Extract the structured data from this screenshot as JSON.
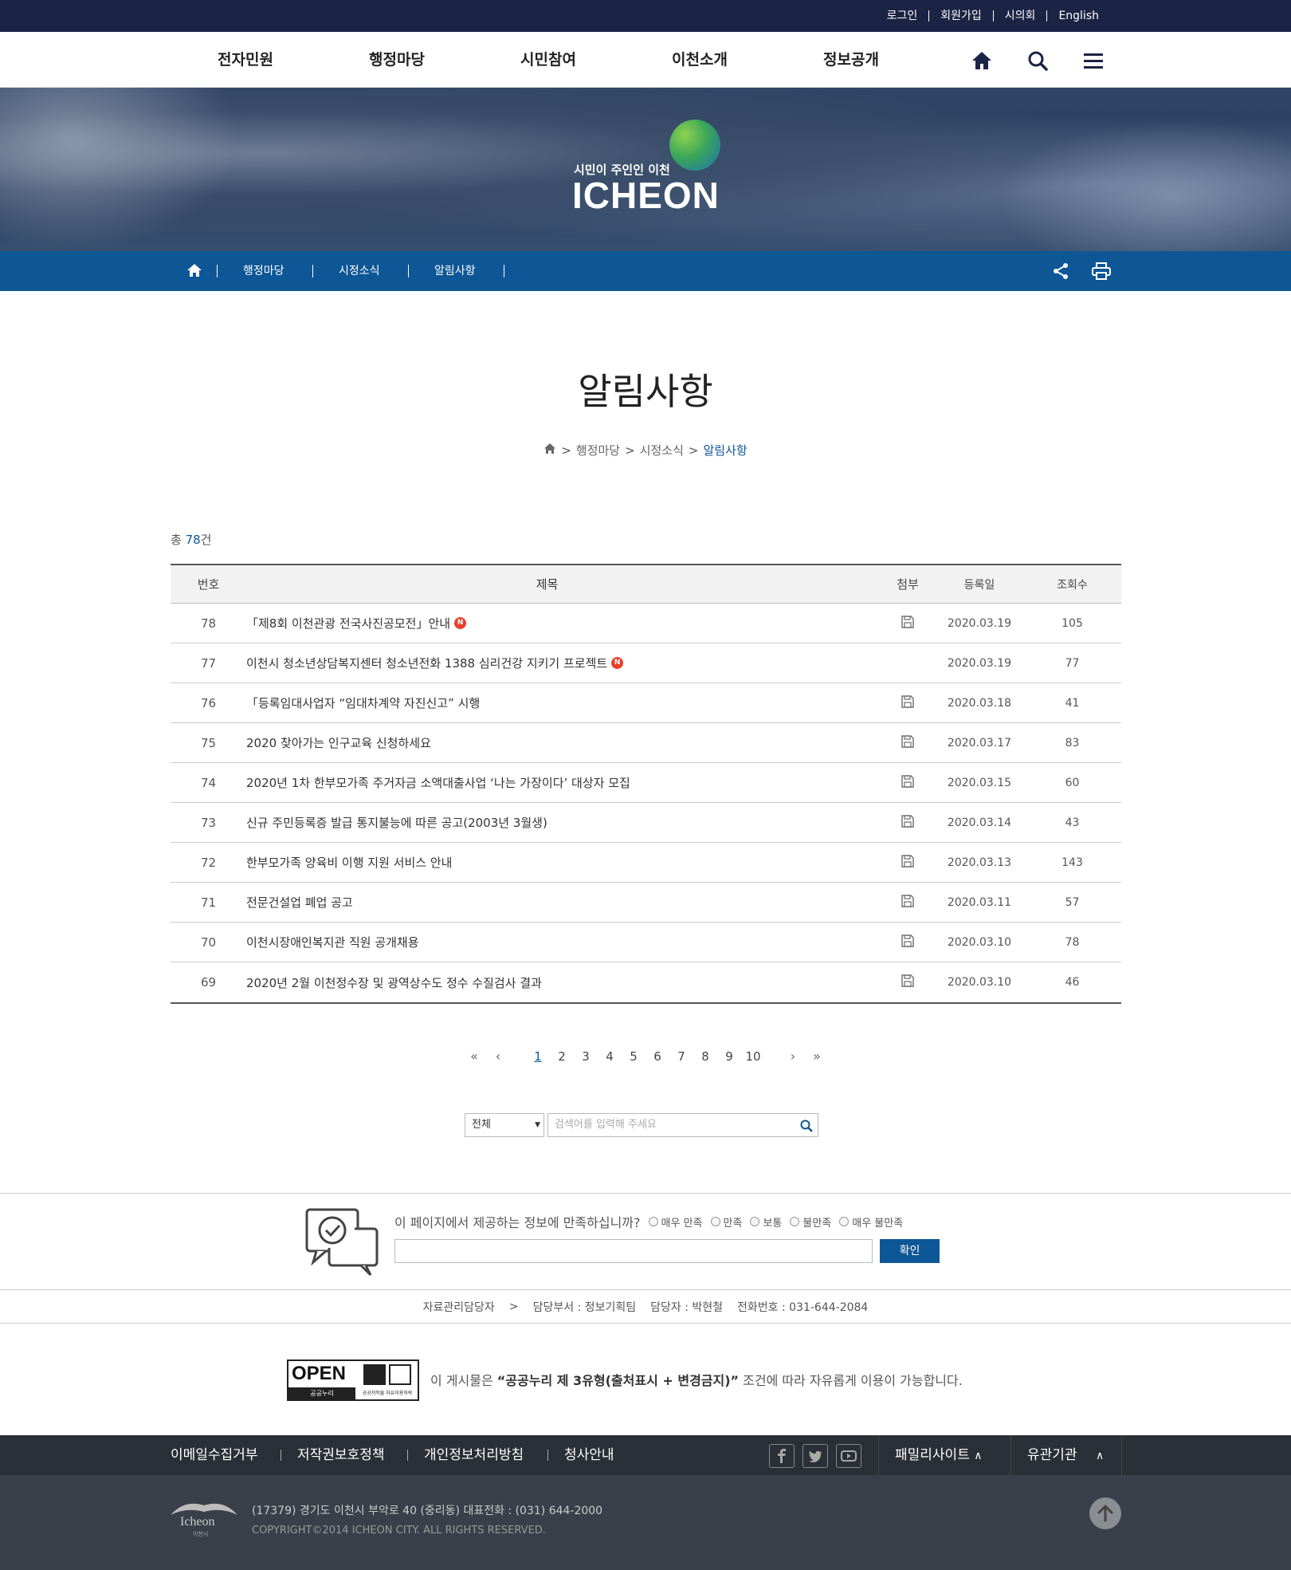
{
  "util": {
    "links": [
      "로그인",
      "회원가입",
      "시의회",
      "English"
    ]
  },
  "gnb": {
    "items": [
      "전자민원",
      "행정마당",
      "시민참여",
      "이천소개",
      "정보공개"
    ]
  },
  "banner": {
    "slogan": "시민이 주인인 이천",
    "logo": "ICHEON"
  },
  "location": {
    "items": [
      "행정마당",
      "시정소식",
      "알림사항"
    ]
  },
  "page": {
    "title": "알림사항",
    "breadcrumb": [
      "행정마당",
      "시정소식",
      "알림사항"
    ],
    "total_prefix": "총 ",
    "total_count": "78",
    "total_suffix": "건"
  },
  "table": {
    "headers": {
      "no": "번호",
      "title": "제목",
      "att": "첨부",
      "date": "등록일",
      "views": "조회수"
    },
    "rows": [
      {
        "no": "78",
        "title": "「제8회 이천관광 전국사진공모전」안내",
        "new": true,
        "att": true,
        "date": "2020.03.19",
        "views": "105"
      },
      {
        "no": "77",
        "title": "이천시 청소년상담복지센터 청소년전화 1388 심리건강 지키기 프로젝트",
        "new": true,
        "att": false,
        "date": "2020.03.19",
        "views": "77"
      },
      {
        "no": "76",
        "title": "「등록임대사업자 “임대차계약 자진신고” 시행",
        "new": false,
        "att": true,
        "date": "2020.03.18",
        "views": "41"
      },
      {
        "no": "75",
        "title": "2020 찾아가는 인구교육 신청하세요",
        "new": false,
        "att": true,
        "date": "2020.03.17",
        "views": "83"
      },
      {
        "no": "74",
        "title": "2020년 1차 한부모가족 주거자금 소액대출사업 ‘나는 가장이다’ 대상자 모집",
        "new": false,
        "att": true,
        "date": "2020.03.15",
        "views": "60"
      },
      {
        "no": "73",
        "title": "신규 주민등록증 발급 통지불능에 따른 공고(2003년 3월생)",
        "new": false,
        "att": true,
        "date": "2020.03.14",
        "views": "43"
      },
      {
        "no": "72",
        "title": "한부모가족 양육비 이행 지원 서비스 안내",
        "new": false,
        "att": true,
        "date": "2020.03.13",
        "views": "143"
      },
      {
        "no": "71",
        "title": "전문건설업 폐업 공고",
        "new": false,
        "att": true,
        "date": "2020.03.11",
        "views": "57"
      },
      {
        "no": "70",
        "title": "이천시장애인복지관 직원 공개채용",
        "new": false,
        "att": true,
        "date": "2020.03.10",
        "views": "78"
      },
      {
        "no": "69",
        "title": "2020년 2월 이천정수장 및 광역상수도 정수 수질검사 결과",
        "new": false,
        "att": true,
        "date": "2020.03.10",
        "views": "46"
      }
    ],
    "new_badge": "N"
  },
  "pager": {
    "first": "«",
    "prev": "‹",
    "pages": [
      "1",
      "2",
      "3",
      "4",
      "5",
      "6",
      "7",
      "8",
      "9",
      "10"
    ],
    "current": "1",
    "next": "›",
    "last": "»"
  },
  "search": {
    "select_value": "전체",
    "placeholder": "검색어를 입력해 주세요"
  },
  "survey": {
    "question": "이 페이지에서 제공하는 정보에 만족하십니까?",
    "options": [
      "매우 만족",
      "만족",
      "보통",
      "불만족",
      "매우 불만족"
    ],
    "submit": "확인"
  },
  "manager": {
    "label": "자료관리담당자",
    "dept": "담당부서 : 정보기획팀",
    "person": "담당자 : 박현철",
    "phone": "전화번호 : 031-644-2084"
  },
  "license": {
    "badge_main": "OPEN",
    "badge_sub1": "공공누리",
    "badge_sub2": "공공저작물 자유이용허락",
    "text_pre": "이 게시물은 ",
    "text_bold": "“공공누리 제 3유형(출처표시 + 변경금지)”",
    "text_post": " 조건에 따라 자유롭게 이용이 가능합니다."
  },
  "footer": {
    "links": [
      "이메일수집거부",
      "저작권보호정책",
      "개인정보처리방침",
      "청사안내"
    ],
    "family": "패밀리사이트",
    "related": "유관기관",
    "address": "(17379) 경기도 이천시 부악로 40 (중리동) 대표전화 : (031) 644-2000",
    "copyright": "COPYRIGHT©2014 ICHEON CITY. ALL RIGHTS RESERVED.",
    "logo_text": "Icheon",
    "logo_sub": "이천시"
  },
  "colors": {
    "navy": "#1b2444",
    "blue": "#0e5796",
    "new": "#e8402c",
    "footer": "#2b2f38"
  }
}
